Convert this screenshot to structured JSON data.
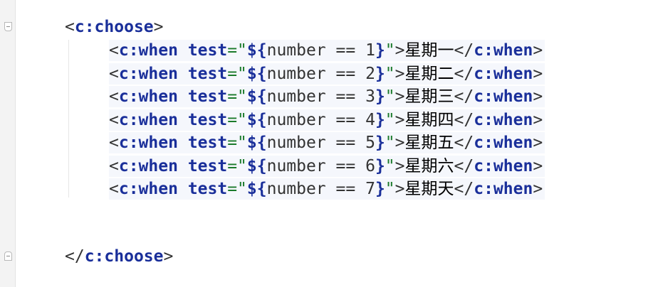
{
  "code": {
    "open_tag": "c:choose",
    "close_tag": "c:choose",
    "when_tag": "c:when",
    "attr_name": "test",
    "el_open": "${",
    "el_close": "}",
    "when_lines": [
      {
        "expr": "number == 1",
        "text": "星期一"
      },
      {
        "expr": "number == 2",
        "text": "星期二"
      },
      {
        "expr": "number == 3",
        "text": "星期三"
      },
      {
        "expr": "number == 4",
        "text": "星期四"
      },
      {
        "expr": "number == 5",
        "text": "星期五"
      },
      {
        "expr": "number == 6",
        "text": "星期六"
      },
      {
        "expr": "number == 7",
        "text": "星期天"
      }
    ]
  },
  "colors": {
    "tag": "#1a2f9a",
    "string": "#1a7a2a",
    "line_highlight": "#f5f7fc",
    "gutter": "#f3f3f3"
  }
}
